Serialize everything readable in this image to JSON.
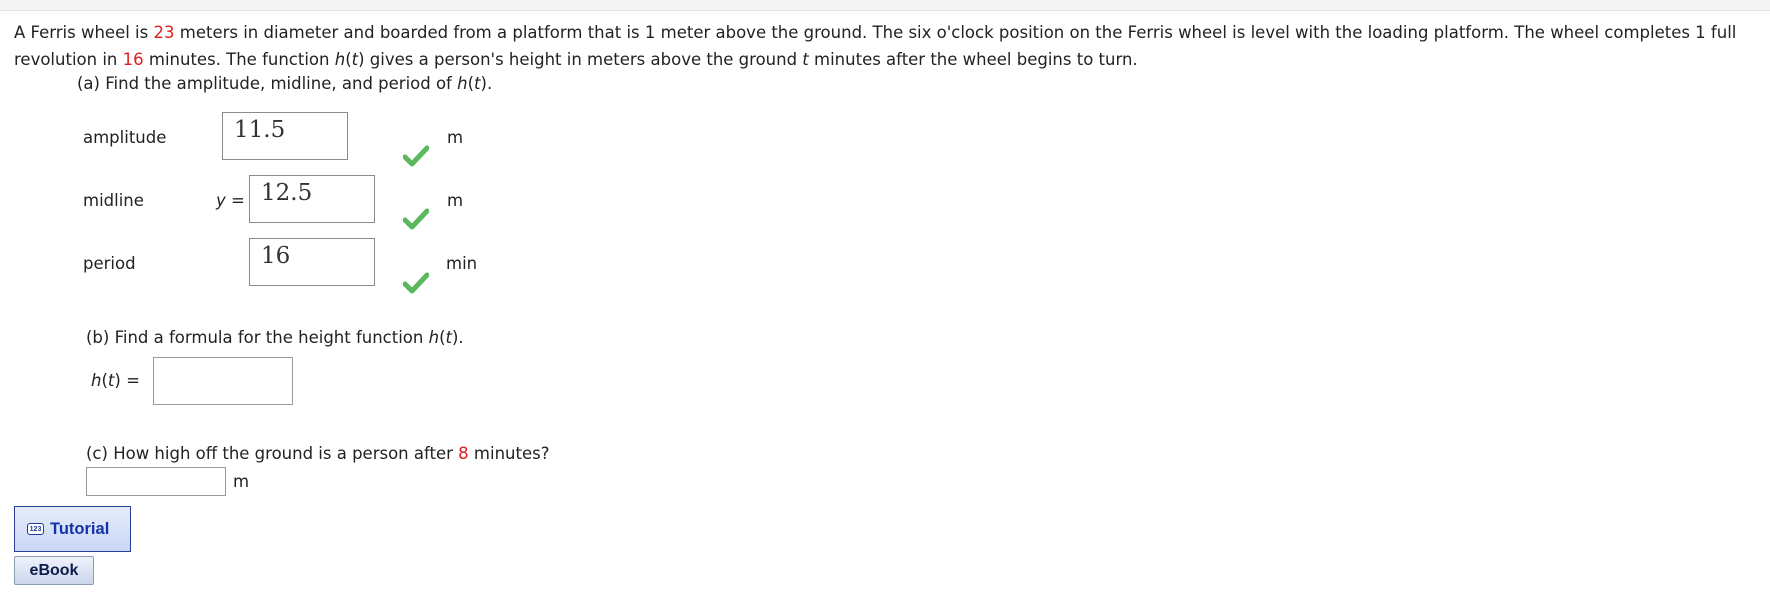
{
  "problem": {
    "p1": "A Ferris wheel is ",
    "diameter": "23",
    "p2": " meters in diameter and boarded from a platform that is 1 meter above the ground. The six o'clock position on the Ferris wheel is level with the loading platform. The wheel completes 1 full revolution in ",
    "rev_minutes": "16",
    "p3": " minutes. The function ",
    "func": "h",
    "open": "(",
    "var": "t",
    "close": ")",
    "p4": " gives a person's height in meters above the ground ",
    "var2": "t",
    "p5": " minutes after the wheel begins to turn."
  },
  "part_a": {
    "prompt_prefix": "(a) Find the amplitude, midline, and period of ",
    "func": "h",
    "open": "(",
    "var": "t",
    "close": ").",
    "rows": [
      {
        "label": "amplitude",
        "prefix": "",
        "value": "11.5",
        "unit": "m",
        "status": "correct"
      },
      {
        "label": "midline",
        "prefix": "y",
        "prefix_eq": " =",
        "value": "12.5",
        "unit": "m",
        "status": "correct"
      },
      {
        "label": "period",
        "prefix": "",
        "value": "16",
        "unit": "min",
        "status": "correct"
      }
    ]
  },
  "part_b": {
    "prompt_prefix": "(b) Find a formula for the height function ",
    "func": "h",
    "open": "(",
    "var": "t",
    "close": ").",
    "lhs_func": "h",
    "lhs_open": "(",
    "lhs_var": "t",
    "lhs_close": ")",
    "lhs_eq": " =",
    "answer": ""
  },
  "part_c": {
    "prompt_prefix": "(c) How high off the ground is a person after ",
    "minutes": "8",
    "prompt_suffix": " minutes?",
    "answer": "",
    "unit": "m"
  },
  "buttons": {
    "tutorial_icon": "123",
    "tutorial": "Tutorial",
    "ebook": "eBook"
  },
  "colors": {
    "highlight": "#e02020",
    "check": "#5cb85c",
    "tutorial_border": "#2a3f9a"
  }
}
